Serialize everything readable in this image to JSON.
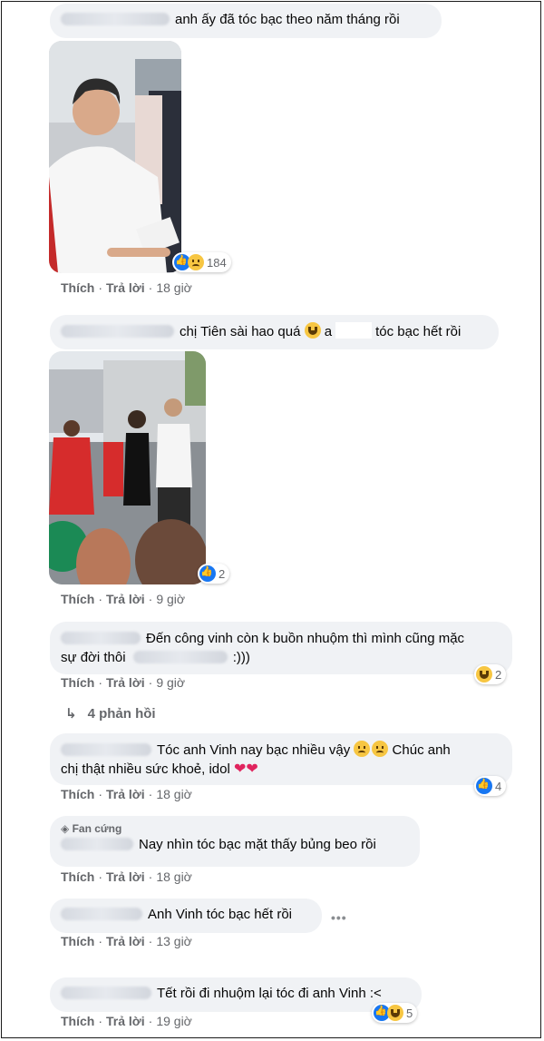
{
  "comments": [
    {
      "text": "anh ấy đã tóc bạc theo năm tháng rồi",
      "like": "Thích",
      "reply": "Trả lời",
      "time": "18 giờ",
      "reaction_count": "184"
    },
    {
      "text_before": "chị Tiên sài hao quá",
      "text_mid": "a",
      "text_after": "tóc bạc hết rồi",
      "like": "Thích",
      "reply": "Trả lời",
      "time": "9 giờ",
      "reaction_count": "2"
    },
    {
      "text_line1": "Đến công vinh còn k buồn nhuộm thì mình cũng mặc",
      "text_line2a": "sự đời thôi",
      "text_line2b": ":)))",
      "like": "Thích",
      "reply": "Trả lời",
      "time": "9 giờ",
      "reaction_count": "2",
      "replies_link": "4 phản hồi"
    },
    {
      "text_line1": "Tóc anh Vinh nay bạc nhiều vậy",
      "text_line1b": "Chúc anh",
      "text_line2": "chị thật nhiều sức khoẻ, idol",
      "like": "Thích",
      "reply": "Trả lời",
      "time": "18 giờ",
      "reaction_count": "4"
    },
    {
      "badge": "Fan cứng",
      "text": "Nay nhìn tóc bạc mặt thấy bủng beo rồi",
      "like": "Thích",
      "reply": "Trả lời",
      "time": "18 giờ"
    },
    {
      "text": "Anh Vinh tóc bạc hết rồi",
      "like": "Thích",
      "reply": "Trả lời",
      "time": "13 giờ"
    },
    {
      "text": "Tết rồi đi nhuộm lại tóc đi anh Vinh :<",
      "like": "Thích",
      "reply": "Trả lời",
      "time": "19 giờ",
      "reaction_count": "5"
    }
  ],
  "icons": {
    "like": "like-reaction-icon",
    "sad": "sad-reaction-icon",
    "laugh": "haha-reaction-icon",
    "heart": "heart-emoji-icon",
    "reply_arrow": "reply-arrow-icon",
    "diamond": "diamond-icon",
    "more": "more-options-icon"
  },
  "colors": {
    "bubble": "#f0f2f5",
    "meta": "#65676b",
    "like_blue": "#1877f2"
  }
}
